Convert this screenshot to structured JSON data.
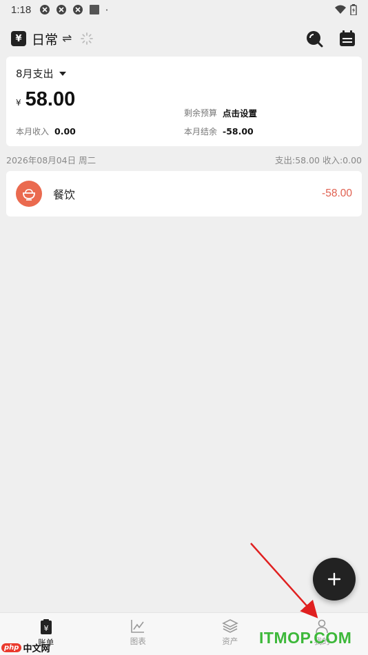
{
  "status_bar": {
    "time": "1:18",
    "icons": [
      "app-notification-icon",
      "app-notification-icon",
      "app-notification-icon",
      "square-notification-icon",
      "dot-icon"
    ],
    "right_icons": [
      "wifi-icon",
      "battery-charging-icon"
    ]
  },
  "app_bar": {
    "book_badge": "¥",
    "book_name": "日常",
    "swap_symbol": "⇌",
    "icons": [
      "swap-icon",
      "loading-icon",
      "search-icon",
      "calendar-icon"
    ]
  },
  "summary": {
    "month_label": "8月支出",
    "currency": "¥",
    "amount": "58.00",
    "budget_label": "剩余预算",
    "budget_value": "点击设置",
    "income_label": "本月收入",
    "income_value": "0.00",
    "balance_label": "本月结余",
    "balance_value": "-58.00"
  },
  "day_group": {
    "date": "2026年08月04日 周二",
    "totals": "支出:58.00  收入:0.00"
  },
  "entries": [
    {
      "category": "餐饮",
      "amount": "-58.00",
      "icon": "bowl-icon",
      "icon_color": "#ea6a4f"
    }
  ],
  "fab": {
    "icon": "plus-icon",
    "symbol": "+"
  },
  "bottom_nav": [
    {
      "label": "账单",
      "icon": "bill-icon",
      "active": true
    },
    {
      "label": "图表",
      "icon": "chart-icon",
      "active": false
    },
    {
      "label": "资产",
      "icon": "layers-icon",
      "active": false
    },
    {
      "label": "我的",
      "icon": "person-icon",
      "active": false
    }
  ],
  "watermarks": {
    "left_badge": "php",
    "left_text": "中文网",
    "right_text": "ITMOP.COM"
  },
  "colors": {
    "accent": "#222222",
    "expense": "#e06050",
    "category": "#ea6a4f",
    "arrow": "#e02020",
    "watermark_green": "#3db83a"
  }
}
